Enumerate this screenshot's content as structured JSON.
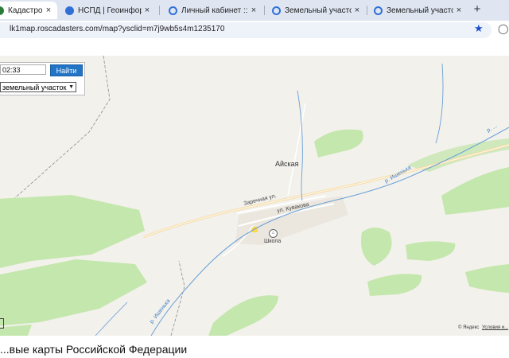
{
  "browser": {
    "tabs": [
      {
        "title": "Кадастровая карта",
        "active": true,
        "icon": "site-icon"
      },
      {
        "title": "НСПД | Геоинформационн...",
        "active": false,
        "icon": "site-icon"
      },
      {
        "title": "Личный кабинет :: Избранн...",
        "active": false,
        "icon": "globe-icon"
      },
      {
        "title": "Земельный участок, площ...",
        "active": false,
        "icon": "globe-icon"
      },
      {
        "title": "Земельный участок, площ...",
        "active": false,
        "icon": "globe-icon"
      }
    ],
    "new_tab_label": "+",
    "close_label": "×",
    "url": "lk1map.roscadasters.com/map?ysclid=m7j9wb5s4m1235170"
  },
  "search": {
    "input_value": "02:33",
    "button_label": "Найти",
    "select_value": "земельный участок"
  },
  "map": {
    "village_label": "Айская",
    "streets": [
      "Заречная ул.",
      "ул. Кувакова"
    ],
    "rivers": [
      "р. Ишенька",
      "р. ...",
      "р. Ишенька"
    ],
    "poi_label": "Школа",
    "attribution": "© Яндекс",
    "terms_label": "Условия и..."
  },
  "footer": {
    "title": "...вые карты Российской Федерации"
  },
  "colors": {
    "accent": "#2274c6",
    "forest": "#bfe5a8",
    "water": "#6aa0d8",
    "road": "#f7e2b4"
  }
}
